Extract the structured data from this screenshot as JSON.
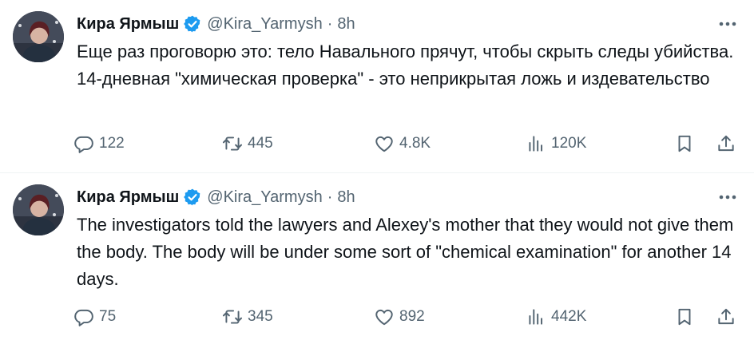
{
  "tweets": [
    {
      "author_name": "Кира Ярмыш",
      "handle": "@Kira_Yarmysh",
      "separator": "·",
      "time": "8h",
      "text": "Еще раз проговорю это: тело Навального прячут, чтобы скрыть следы убийства. 14-дневная \"химическая проверка\" - это неприкрытая ложь и издевательство",
      "replies": "122",
      "reposts": "445",
      "likes": "4.8K",
      "views": "120K"
    },
    {
      "author_name": "Кира Ярмыш",
      "handle": "@Kira_Yarmysh",
      "separator": "·",
      "time": "8h",
      "text": "The investigators told the lawyers and Alexey's mother that they would not give them the body. The body will be under some sort of \"chemical examination\" for another 14 days.",
      "replies": "75",
      "reposts": "345",
      "likes": "892",
      "views": "442K"
    }
  ],
  "icons": {
    "verified": "verified-badge-icon",
    "more": "more-options-icon",
    "reply": "reply-icon",
    "repost": "repost-icon",
    "like": "like-icon",
    "views": "views-icon",
    "bookmark": "bookmark-icon",
    "share": "share-icon"
  },
  "colors": {
    "text": "#0f1419",
    "secondary": "#536471",
    "verified": "#1d9bf0",
    "divider": "#eff3f4"
  }
}
